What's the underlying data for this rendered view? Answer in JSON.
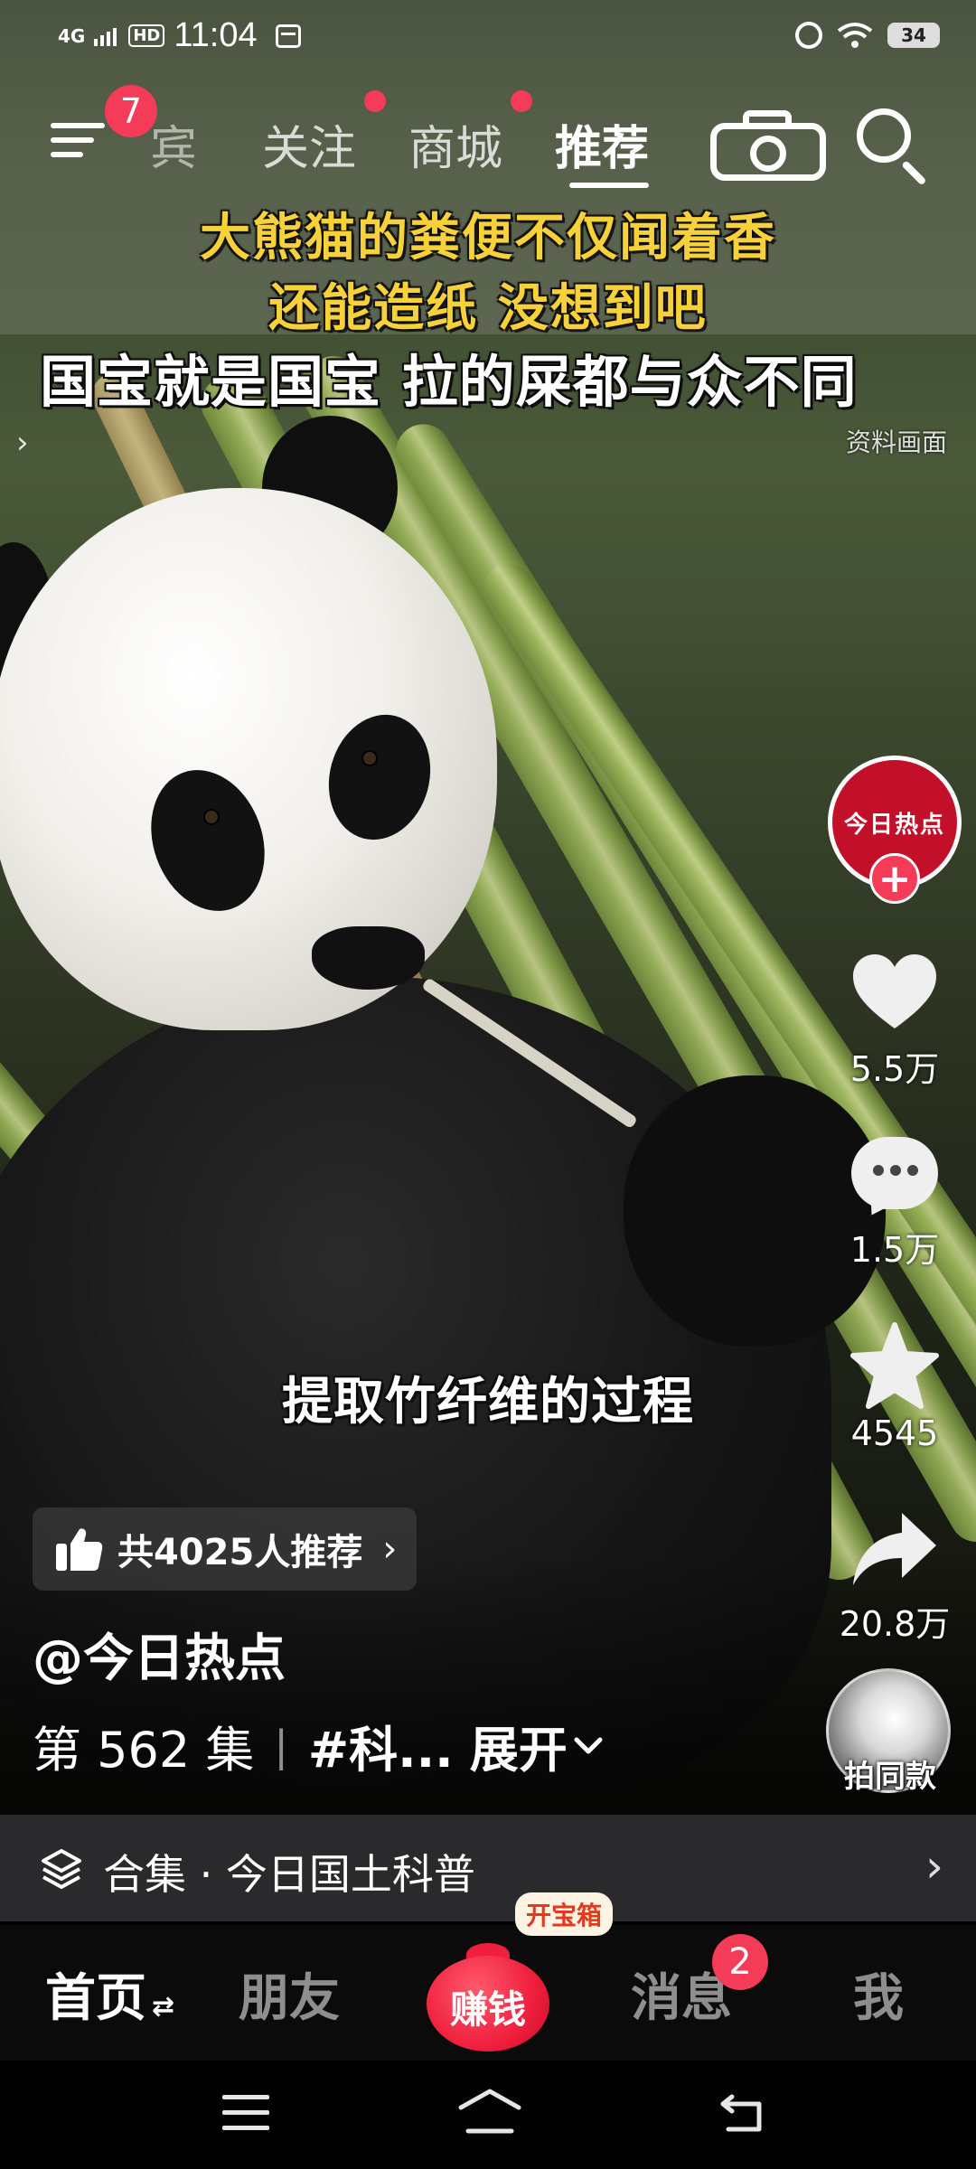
{
  "status_bar": {
    "network": "4G",
    "hd": "HD",
    "time": "11:04",
    "battery": "34"
  },
  "top_nav": {
    "menu_badge": "7",
    "tabs": [
      {
        "label": "宾"
      },
      {
        "label": "关注"
      },
      {
        "label": "商城"
      },
      {
        "label": "推荐"
      }
    ],
    "active_tab": "推荐"
  },
  "video": {
    "caption_line1": "大熊猫的粪便不仅闻着香",
    "caption_line2": "还能造纸 没想到吧",
    "headline": "国宝就是国宝 拉的屎都与众不同",
    "watermark": "资料画面",
    "subtitle": "提取竹纤维的过程"
  },
  "side_actions": {
    "avatar_text": "今日热点",
    "follow_plus": "+",
    "likes": "5.5万",
    "comments": "1.5万",
    "favorites": "4545",
    "shares": "20.8万",
    "same_style_label": "拍同款"
  },
  "recommend": {
    "text": "共4025人推荐",
    "chevron": "›"
  },
  "post": {
    "author": "@今日热点",
    "episode": "第 562 集",
    "separator": "|",
    "hashtag": "#科...",
    "expand": "展开"
  },
  "collection": {
    "label": "合集 · 今日国土科普",
    "chevron": "›"
  },
  "bottom_tabs": {
    "home": "首页",
    "home_switch": "⇄",
    "friends": "朋友",
    "earn": "赚钱",
    "earn_bubble": "开宝箱",
    "messages": "消息",
    "messages_badge": "2",
    "me": "我"
  },
  "colors": {
    "accent_red": "#f43b57",
    "caption_yellow": "#f6d13a",
    "collection_bg": "#2a2a2c"
  }
}
